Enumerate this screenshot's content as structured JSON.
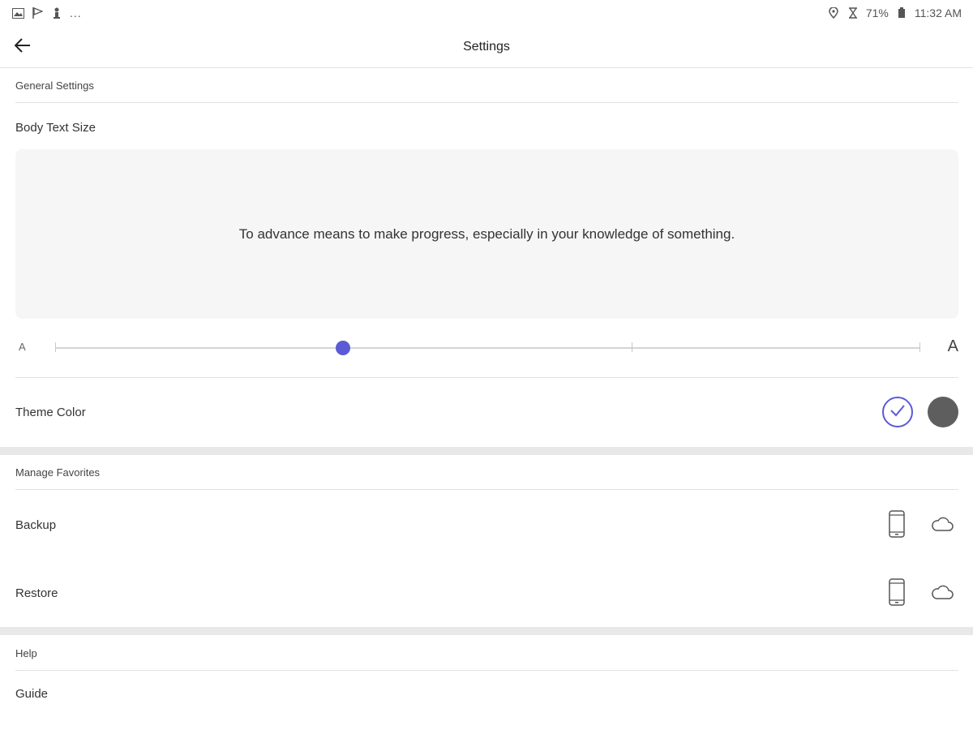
{
  "status_bar": {
    "left_icons": [
      "gallery-icon",
      "flag-icon",
      "figure-icon"
    ],
    "more": "...",
    "right_icons": [
      "location-icon",
      "hourglass-icon",
      "lock-battery-icon"
    ],
    "battery": "71%",
    "time": "11:32 AM"
  },
  "app_bar": {
    "back_icon": "back-arrow-icon",
    "title": "Settings"
  },
  "general": {
    "header": "General Settings",
    "body_text_size_label": "Body Text Size",
    "preview_text": "To advance means to make progress, especially in your knowledge of something.",
    "slider": {
      "small_label": "A",
      "large_label": "A",
      "steps": 4,
      "selected_step_index": 1,
      "accent": "#5b5bd6"
    },
    "theme_label": "Theme Color",
    "themes": [
      {
        "name": "light",
        "selected": true,
        "color": "#ffffff",
        "accent": "#5b5bd6"
      },
      {
        "name": "dark",
        "selected": false,
        "color": "#5e5e5e"
      }
    ]
  },
  "favorites": {
    "header": "Manage Favorites",
    "items": [
      {
        "label": "Backup",
        "icons": [
          "phone-icon",
          "cloud-icon"
        ]
      },
      {
        "label": "Restore",
        "icons": [
          "phone-icon",
          "cloud-icon"
        ]
      }
    ]
  },
  "help": {
    "header": "Help",
    "items": [
      {
        "label": "Guide"
      }
    ]
  }
}
